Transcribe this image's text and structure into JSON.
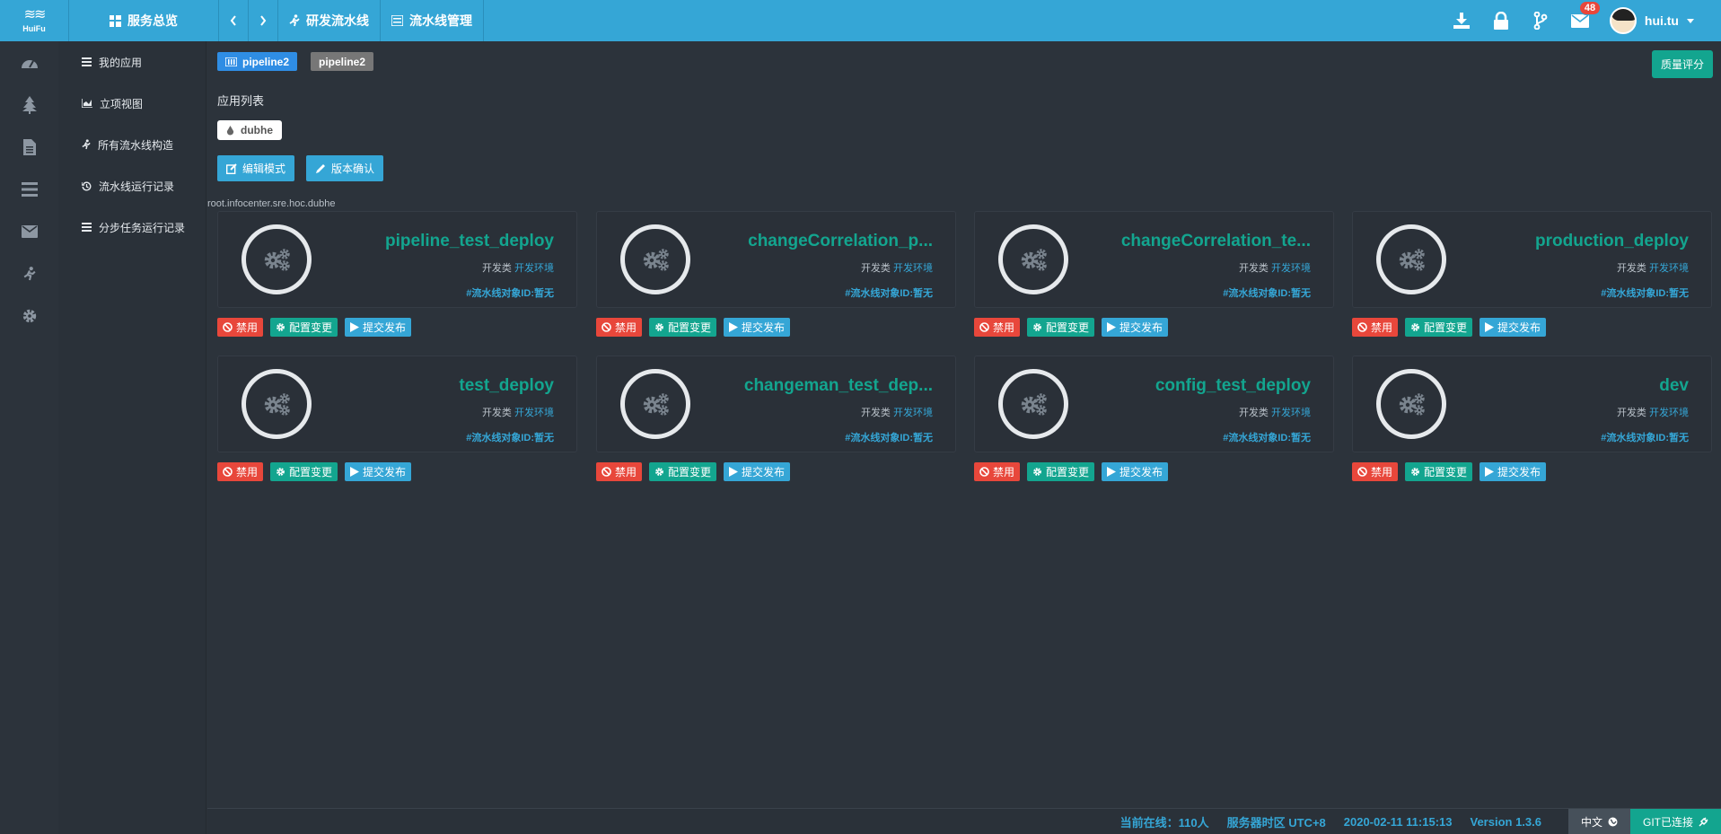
{
  "logo": {
    "mark": "≋≋",
    "text": "HuiFu"
  },
  "topbar": {
    "overview_label": "服务总览",
    "prev_icon": "chevron-left-icon",
    "next_icon": "chevron-right-icon",
    "breadcrumb": [
      {
        "label": "研发流水线",
        "icon": "runner-icon"
      },
      {
        "label": "流水线管理",
        "icon": "list-icon"
      }
    ],
    "notification_count": "48",
    "username": "hui.tu"
  },
  "iconcol": [
    "dashboard-icon",
    "tree-icon",
    "document-icon",
    "list-icon",
    "mail-icon",
    "runner-icon",
    "gear-icon"
  ],
  "subnav": [
    {
      "label": "我的应用",
      "icon": "list-icon"
    },
    {
      "label": "立项视图",
      "icon": "chart-icon"
    },
    {
      "label": "所有流水线构造",
      "icon": "runner-icon"
    },
    {
      "label": "流水线运行记录",
      "icon": "history-icon"
    },
    {
      "label": "分步任务运行记录",
      "icon": "list-icon"
    }
  ],
  "main": {
    "tag_active": "pipeline2",
    "tag_inactive": "pipeline2",
    "quality_button": "质量评分",
    "section_title": "应用列表",
    "app_chip": "dubhe",
    "edit_button": "编辑模式",
    "version_button": "版本确认",
    "path": "root.infocenter.sre.hoc.dubhe"
  },
  "card_labels": {
    "type": "开发类",
    "env": "开发环境",
    "id": "#流水线对象ID:暂无",
    "disable": "禁用",
    "config": "配置变更",
    "publish": "提交发布"
  },
  "pipelines": [
    {
      "name": "pipeline_test_deploy"
    },
    {
      "name": "changeCorrelation_p..."
    },
    {
      "name": "changeCorrelation_te..."
    },
    {
      "name": "production_deploy"
    },
    {
      "name": "test_deploy"
    },
    {
      "name": "changeman_test_dep..."
    },
    {
      "name": "config_test_deploy"
    },
    {
      "name": "dev"
    }
  ],
  "footer": {
    "online": "当前在线：110人",
    "timezone": "服务器时区 UTC+8",
    "datetime": "2020-02-11 11:15:13",
    "version": "Version 1.3.6",
    "language": "中文",
    "git": "GIT已连接"
  },
  "colors": {
    "primary": "#35a6d6",
    "teal": "#13a58f",
    "danger": "#e8473b",
    "bg": "#2c333b"
  }
}
